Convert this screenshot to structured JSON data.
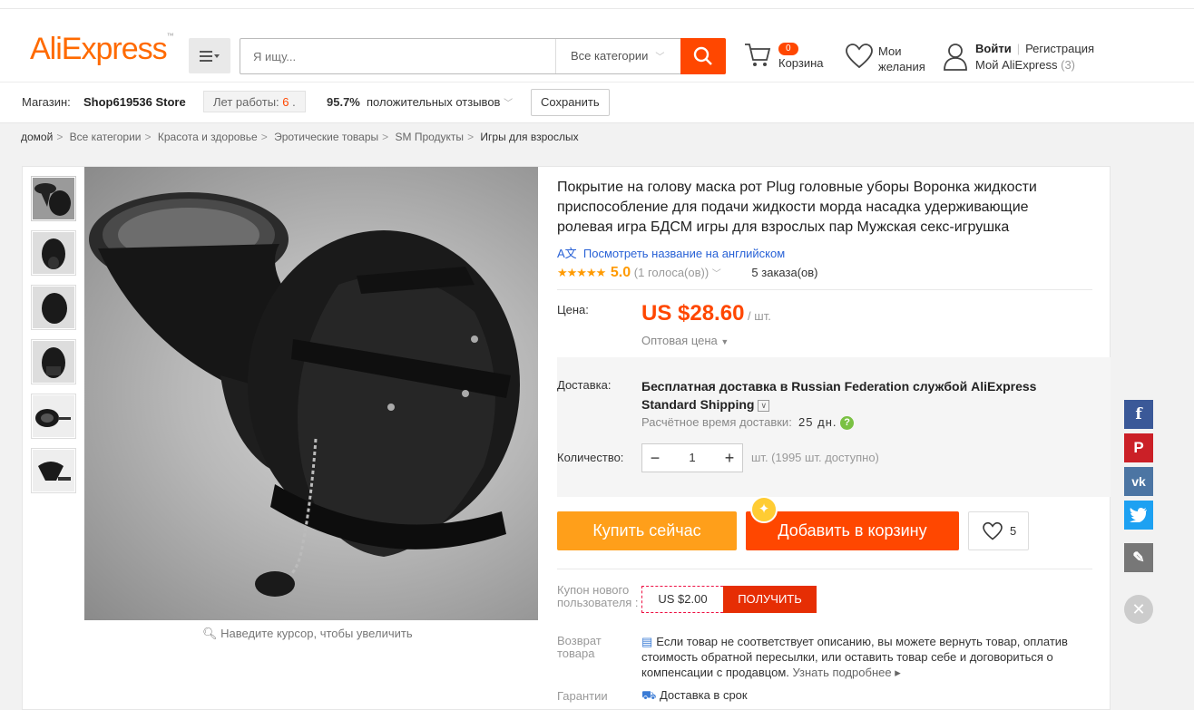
{
  "header": {
    "logo": "AliExpress",
    "logo_tm": "™",
    "search_placeholder": "Я ищу...",
    "search_category": "Все категории",
    "cart_count": "0",
    "cart_label": "Корзина",
    "wishlist_line1": "Мои",
    "wishlist_line2": "желания",
    "signin": "Войти",
    "register": "Регистрация",
    "my_ali": "Мой AliExpress",
    "my_ali_count": "(3)"
  },
  "store": {
    "label": "Магазин:",
    "name": "Shop619536 Store",
    "years_label": "Лет работы:",
    "years_value": "6",
    "years_dot": ".",
    "feedback_pct": "95.7%",
    "feedback_label": "положительных отзывов",
    "save_button": "Сохранить"
  },
  "breadcrumbs": [
    "домой",
    "Все категории",
    "Красота и здоровье",
    "Эротические товары",
    "SM Продукты",
    "Игры для взрослых"
  ],
  "gallery": {
    "zoom_hint": "Наведите курсор, чтобы увеличить"
  },
  "product": {
    "title": "Покрытие на голову маска рот Plug головные уборы Воронка жидкости приспособление для подачи жидкости морда насадка удерживающие ролевая игра БДСМ игры для взрослых пар Мужская секс-игрушка",
    "translate_link": "Посмотреть название на английском",
    "rating_value": 5.0,
    "rating_text": "5.0",
    "votes": "(1 голоса(ов))",
    "orders": "5 заказа(ов)",
    "price_label": "Цена:",
    "price": "US $28.60",
    "price_unit": "/ шт.",
    "wholesale": "Оптовая цена",
    "shipping_label": "Доставка:",
    "shipping_text": "Бесплатная доставка в Russian Federation службой AliExpress Standard Shipping",
    "eta_label": "Расчётное время доставки:",
    "eta_value": "25 дн.",
    "qty_label": "Количество:",
    "qty_value": "1",
    "qty_avail": "шт. (1995 шт. доступно)",
    "buy_now": "Купить сейчас",
    "add_to_cart": "Добавить в корзину",
    "wish_count": "5",
    "coupon_label": "Купон нового пользователя :",
    "coupon_value": "US $2.00",
    "coupon_get": "ПОЛУЧИТЬ",
    "return_label": "Возврат товара",
    "return_text": "Если товар не соответствует описанию, вы можете вернуть товар, оплатив стоимость обратной пересылки, или оставить товар себе и договориться о компенсации с продавцом.",
    "return_more": "Узнать подробнее",
    "guarantee_label": "Гарантии",
    "guarantee_text": "Доставка в срок"
  },
  "colors": {
    "accent": "#ff4700",
    "buy_now": "#ff9f1a",
    "link": "#2962d6",
    "star": "#ff9a00"
  },
  "social": [
    "facebook-icon",
    "pinterest-icon",
    "vk-icon",
    "twitter-icon",
    "edit-icon",
    "close-icon"
  ]
}
